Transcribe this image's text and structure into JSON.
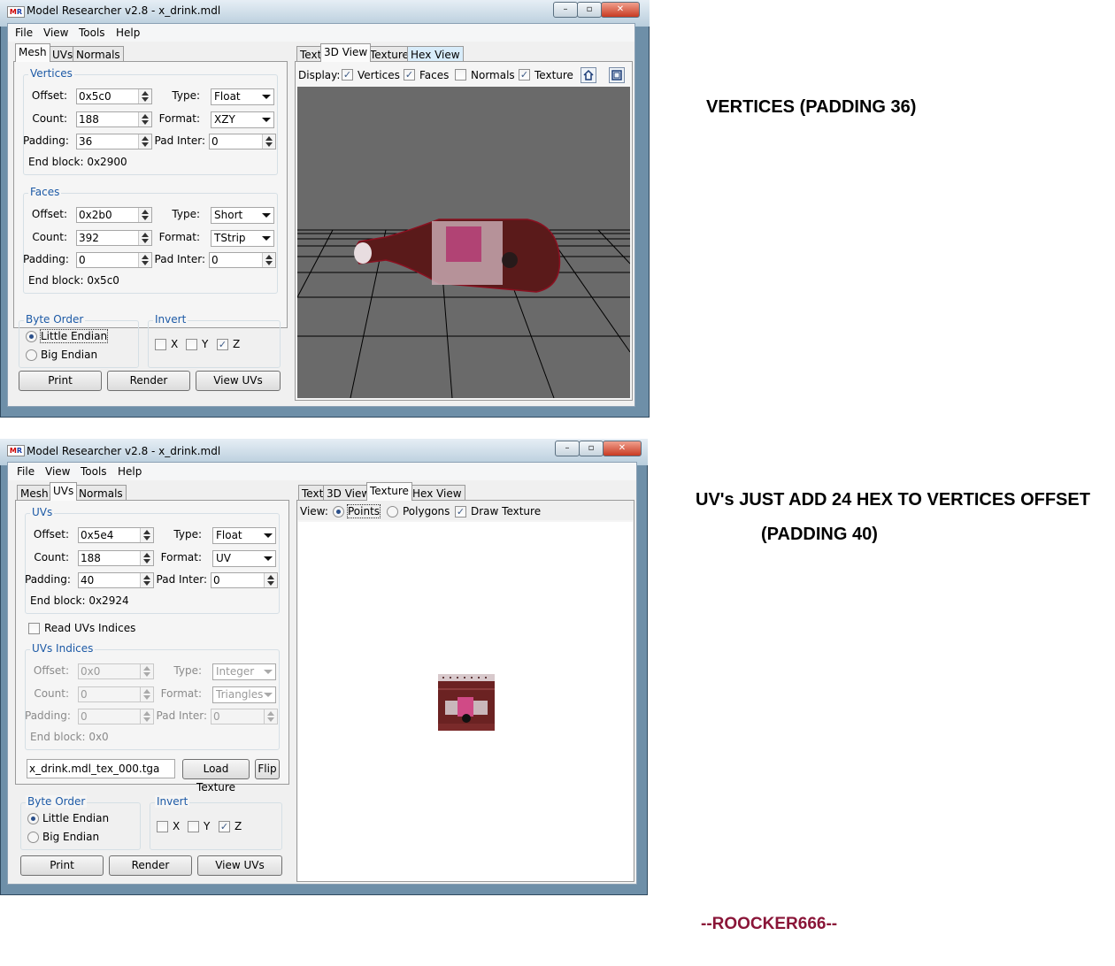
{
  "window1": {
    "title": "Model Researcher v2.8 - x_drink.mdl",
    "menu": [
      "File",
      "View",
      "Tools",
      "Help"
    ],
    "left_tabs": [
      "Mesh",
      "UVs",
      "Normals"
    ],
    "right_tabs": [
      "Text",
      "3D View",
      "Texture",
      "Hex View"
    ],
    "vertices": {
      "title": "Vertices",
      "offset_label": "Offset:",
      "offset": "0x5c0",
      "count_label": "Count:",
      "count": "188",
      "padding_label": "Padding:",
      "padding": "36",
      "type_label": "Type:",
      "type": "Float",
      "format_label": "Format:",
      "format": "XZY",
      "pad_inter_label": "Pad Inter:",
      "pad_inter": "0",
      "end_block": "End block: 0x2900"
    },
    "faces": {
      "title": "Faces",
      "offset_label": "Offset:",
      "offset": "0x2b0",
      "count_label": "Count:",
      "count": "392",
      "padding_label": "Padding:",
      "padding": "0",
      "type_label": "Type:",
      "type": "Short",
      "format_label": "Format:",
      "format": "TStrip",
      "pad_inter_label": "Pad Inter:",
      "pad_inter": "0",
      "end_block": "End block: 0x5c0"
    },
    "byte_order": {
      "title": "Byte Order",
      "little": "Little Endian",
      "big": "Big Endian"
    },
    "invert": {
      "title": "Invert",
      "x": "X",
      "y": "Y",
      "z": "Z"
    },
    "buttons": {
      "print": "Print",
      "render": "Render",
      "view_uvs": "View UVs"
    },
    "display": {
      "label": "Display:",
      "vertices": "Vertices",
      "faces": "Faces",
      "normals": "Normals",
      "texture": "Texture"
    }
  },
  "window2": {
    "title": "Model Researcher v2.8 - x_drink.mdl",
    "menu": [
      "File",
      "View",
      "Tools",
      "Help"
    ],
    "left_tabs": [
      "Mesh",
      "UVs",
      "Normals"
    ],
    "right_tabs": [
      "Text",
      "3D View",
      "Texture",
      "Hex View"
    ],
    "uvs": {
      "title": "UVs",
      "offset_label": "Offset:",
      "offset": "0x5e4",
      "count_label": "Count:",
      "count": "188",
      "padding_label": "Padding:",
      "padding": "40",
      "type_label": "Type:",
      "type": "Float",
      "format_label": "Format:",
      "format": "UV",
      "pad_inter_label": "Pad Inter:",
      "pad_inter": "0",
      "end_block": "End block: 0x2924"
    },
    "read_uvs_indices": "Read UVs Indices",
    "uvs_indices": {
      "title": "UVs Indices",
      "offset_label": "Offset:",
      "offset": "0x0",
      "count_label": "Count:",
      "count": "0",
      "padding_label": "Padding:",
      "padding": "0",
      "type_label": "Type:",
      "type": "Integer",
      "format_label": "Format:",
      "format": "Triangles",
      "pad_inter_label": "Pad Inter:",
      "pad_inter": "0",
      "end_block": "End block: 0x0"
    },
    "texture_file": "x_drink.mdl_tex_000.tga",
    "load_texture": "Load Texture",
    "flip": "Flip",
    "byte_order": {
      "title": "Byte Order",
      "little": "Little Endian",
      "big": "Big Endian"
    },
    "invert": {
      "title": "Invert",
      "x": "X",
      "y": "Y",
      "z": "Z"
    },
    "buttons": {
      "print": "Print",
      "render": "Render",
      "view_uvs": "View UVs"
    },
    "view": {
      "label": "View:",
      "points": "Points",
      "polygons": "Polygons",
      "draw_texture": "Draw Texture"
    }
  },
  "annotations": {
    "vertices_note": "VERTICES (PADDING 36)",
    "uvs_note_line1": "UV's JUST ADD 24 HEX TO VERTICES OFFSET",
    "uvs_note_line2": "(PADDING 40)",
    "signature": "--ROOCKER666--"
  },
  "colors": {
    "signature": "#8a1538",
    "group_title": "#1d5aa6",
    "viewport_bg": "#6a6a6a"
  }
}
